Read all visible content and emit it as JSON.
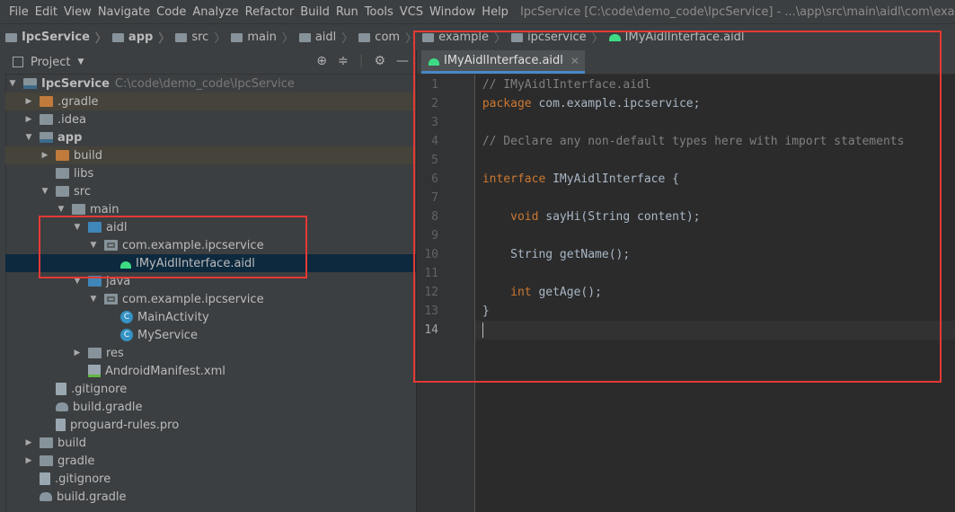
{
  "app": {
    "window_title": "IpcService [C:\\code\\demo_code\\IpcService] - ...\\app\\src\\main\\aidl\\com\\examp"
  },
  "menu": [
    "File",
    "Edit",
    "View",
    "Navigate",
    "Code",
    "Analyze",
    "Refactor",
    "Build",
    "Run",
    "Tools",
    "VCS",
    "Window",
    "Help"
  ],
  "breadcrumb": [
    "IpcService",
    "app",
    "src",
    "main",
    "aidl",
    "com",
    "example",
    "ipcservice",
    "IMyAidlInterface.aidl"
  ],
  "project_panel": {
    "title": "Project",
    "tree": [
      {
        "label": "IpcService",
        "path": "C:\\code\\demo_code\\IpcService",
        "icon": "module-icon",
        "depth": 0,
        "expanded": true
      },
      {
        "label": ".gradle",
        "icon": "folder-orange-icon",
        "depth": 1,
        "expanded": false,
        "highlight": true
      },
      {
        "label": ".idea",
        "icon": "folder-icon",
        "depth": 1,
        "expanded": false
      },
      {
        "label": "app",
        "icon": "module-icon",
        "depth": 1,
        "expanded": true
      },
      {
        "label": "build",
        "icon": "folder-orange-icon",
        "depth": 2,
        "expanded": false,
        "highlight": true
      },
      {
        "label": "libs",
        "icon": "folder-icon",
        "depth": 2
      },
      {
        "label": "src",
        "icon": "folder-icon",
        "depth": 2,
        "expanded": true
      },
      {
        "label": "main",
        "icon": "folder-icon",
        "depth": 3,
        "expanded": true
      },
      {
        "label": "aidl",
        "icon": "folder-blue-icon",
        "depth": 4,
        "expanded": true
      },
      {
        "label": "com.example.ipcservice",
        "icon": "package-icon",
        "depth": 5,
        "expanded": true
      },
      {
        "label": "IMyAidlInterface.aidl",
        "icon": "android-icon",
        "depth": 6,
        "selected": true
      },
      {
        "label": "java",
        "icon": "folder-blue-icon",
        "depth": 4,
        "expanded": true
      },
      {
        "label": "com.example.ipcservice",
        "icon": "package-icon",
        "depth": 5,
        "expanded": true
      },
      {
        "label": "MainActivity",
        "icon": "class-icon",
        "depth": 6
      },
      {
        "label": "MyService",
        "icon": "class-icon",
        "depth": 6
      },
      {
        "label": "res",
        "icon": "folder-icon",
        "depth": 4,
        "expanded": false
      },
      {
        "label": "AndroidManifest.xml",
        "icon": "manifest-icon",
        "depth": 4
      },
      {
        "label": ".gitignore",
        "icon": "gitignore-icon",
        "depth": 2
      },
      {
        "label": "build.gradle",
        "icon": "gradle-icon",
        "depth": 2
      },
      {
        "label": "proguard-rules.pro",
        "icon": "file-icon",
        "depth": 2
      },
      {
        "label": "build",
        "icon": "folder-icon",
        "depth": 1,
        "expanded": false
      },
      {
        "label": "gradle",
        "icon": "folder-icon",
        "depth": 1,
        "expanded": false
      },
      {
        "label": ".gitignore",
        "icon": "gitignore-icon",
        "depth": 1
      },
      {
        "label": "build.gradle",
        "icon": "gradle-icon",
        "depth": 1
      }
    ]
  },
  "editor": {
    "tab_label": "IMyAidlInterface.aidl",
    "current_line": 14,
    "lines": [
      {
        "n": "1",
        "tokens": [
          {
            "t": "// IMyAidlInterface.aidl",
            "c": "cm"
          }
        ]
      },
      {
        "n": "2",
        "tokens": [
          {
            "t": "package",
            "c": "kw"
          },
          {
            "t": " com.example.ipcservice;",
            "c": ""
          }
        ]
      },
      {
        "n": "3",
        "tokens": []
      },
      {
        "n": "4",
        "tokens": [
          {
            "t": "// Declare any non-default types here with import statements",
            "c": "cm"
          }
        ]
      },
      {
        "n": "5",
        "tokens": []
      },
      {
        "n": "6",
        "tokens": [
          {
            "t": "interface",
            "c": "kw"
          },
          {
            "t": " IMyAidlInterface {",
            "c": ""
          }
        ]
      },
      {
        "n": "7",
        "tokens": []
      },
      {
        "n": "8",
        "tokens": [
          {
            "t": "    ",
            "c": ""
          },
          {
            "t": "void",
            "c": "kw"
          },
          {
            "t": " sayHi(String content);",
            "c": ""
          }
        ]
      },
      {
        "n": "9",
        "tokens": []
      },
      {
        "n": "10",
        "tokens": [
          {
            "t": "    String getName();",
            "c": ""
          }
        ]
      },
      {
        "n": "11",
        "tokens": []
      },
      {
        "n": "12",
        "tokens": [
          {
            "t": "    ",
            "c": ""
          },
          {
            "t": "int",
            "c": "kw"
          },
          {
            "t": " getAge();",
            "c": ""
          }
        ]
      },
      {
        "n": "13",
        "tokens": [
          {
            "t": "}",
            "c": ""
          }
        ]
      },
      {
        "n": "14",
        "tokens": []
      }
    ]
  },
  "colors": {
    "highlight_box": "#e53935",
    "selection": "#0d293e",
    "keyword": "#cc7832",
    "comment": "#808080"
  }
}
